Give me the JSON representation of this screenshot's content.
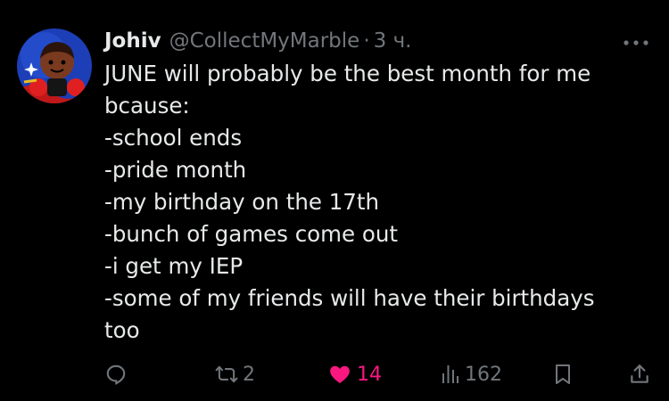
{
  "post": {
    "author": {
      "display_name": "Johiv",
      "handle": "@CollectMyMarble",
      "separator": "·",
      "timestamp": "3 ч."
    },
    "text": "JUNE will probably be the best month for me\nbcause:\n-school ends\n-pride month\n-my birthday on the 17th\n-bunch of games come out\n-i get my IEP\n-some of my friends will have their birthdays\ntoo",
    "menu_icon": "more-horizontal-icon",
    "actions": {
      "reply": {
        "icon": "reply-icon",
        "count": ""
      },
      "repost": {
        "icon": "repost-icon",
        "count": "2"
      },
      "like": {
        "icon": "heart-filled-icon",
        "count": "14",
        "liked": true,
        "color": "#f91880"
      },
      "views": {
        "icon": "views-bar-chart-icon",
        "count": "162"
      },
      "bookmark": {
        "icon": "bookmark-icon"
      },
      "share": {
        "icon": "share-upload-icon"
      }
    }
  },
  "colors": {
    "background": "#000000",
    "primary_text": "#e7e9ea",
    "secondary_text": "#71767b",
    "like": "#f91880"
  }
}
